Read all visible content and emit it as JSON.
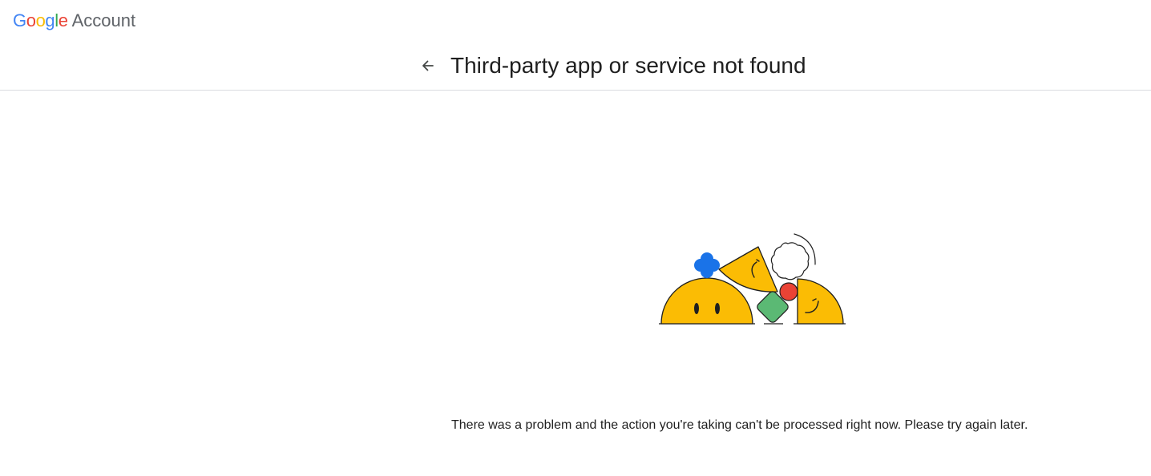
{
  "header": {
    "brand_letters": [
      {
        "char": "G",
        "color": "#4285F4"
      },
      {
        "char": "o",
        "color": "#EA4335"
      },
      {
        "char": "o",
        "color": "#FBBC04"
      },
      {
        "char": "g",
        "color": "#4285F4"
      },
      {
        "char": "l",
        "color": "#34A853"
      },
      {
        "char": "e",
        "color": "#EA4335"
      }
    ],
    "product_name": "Account"
  },
  "page": {
    "back_icon": "arrow-back-icon",
    "title": "Third-party app or service not found"
  },
  "illustration": {
    "name": "error-characters-illustration",
    "colors": {
      "yellow": "#FBBC04",
      "blue": "#1A73E8",
      "red": "#EA4335",
      "green": "#5BB974",
      "outline": "#1f1f1f"
    }
  },
  "error": {
    "message": "There was a problem and the action you're taking can't be processed right now. Please try again later."
  }
}
